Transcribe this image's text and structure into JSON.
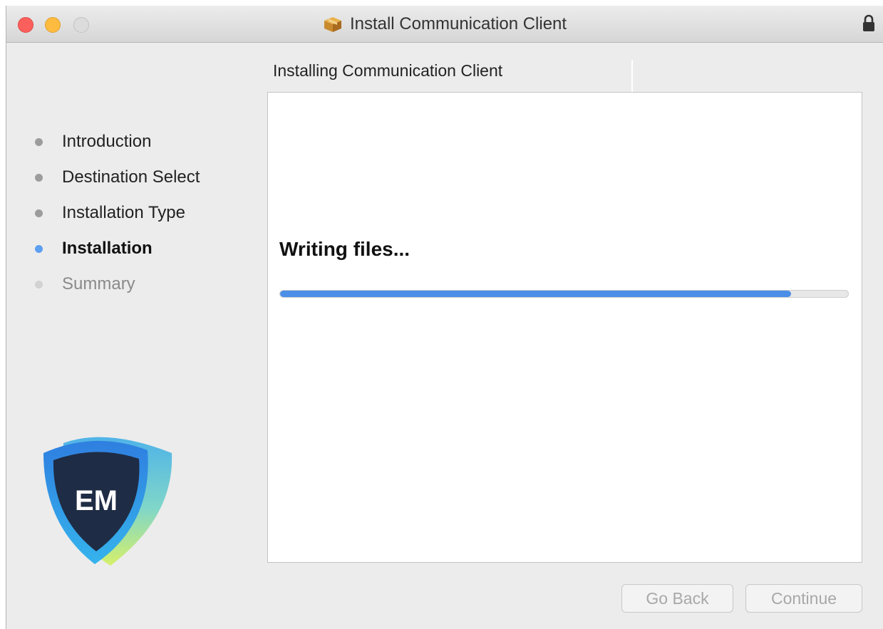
{
  "window": {
    "title": "Install Communication Client",
    "icon": "package-icon",
    "lock_icon": "lock-icon"
  },
  "pane": {
    "title": "Installing Communication Client"
  },
  "steps": [
    {
      "label": "Introduction",
      "state": "done"
    },
    {
      "label": "Destination Select",
      "state": "done"
    },
    {
      "label": "Installation Type",
      "state": "done"
    },
    {
      "label": "Installation",
      "state": "active"
    },
    {
      "label": "Summary",
      "state": "pending"
    }
  ],
  "installer": {
    "status": "Writing files...",
    "progress": 0.9
  },
  "logo": {
    "text": "EM"
  },
  "buttons": {
    "back": "Go Back",
    "continue": "Continue"
  },
  "colors": {
    "accent": "#4a8ee8",
    "close": "#fc605c",
    "minimize": "#fdbc40"
  }
}
